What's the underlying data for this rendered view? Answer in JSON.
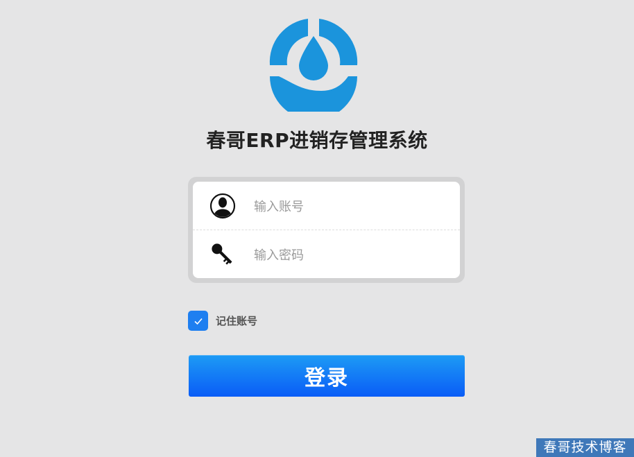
{
  "app": {
    "title": "春哥ERP进销存管理系统"
  },
  "login": {
    "account_placeholder": "输入账号",
    "password_placeholder": "输入密码",
    "remember_label": "记住账号",
    "remember_checked": true,
    "submit_label": "登录"
  },
  "icons": {
    "logo": "water-drop-logo-icon",
    "account": "user-avatar-icon",
    "password": "key-icon",
    "checkbox": "checkmark-icon"
  },
  "colors": {
    "background": "#e5e5e6",
    "logo_blue": "#1b94dc",
    "accent_blue": "#1e7ff0",
    "button_top": "#1d9bf5",
    "button_bottom": "#0a5cf6",
    "watermark_bg": "#3f78b9"
  },
  "watermark": {
    "text": "春哥技术博客"
  }
}
